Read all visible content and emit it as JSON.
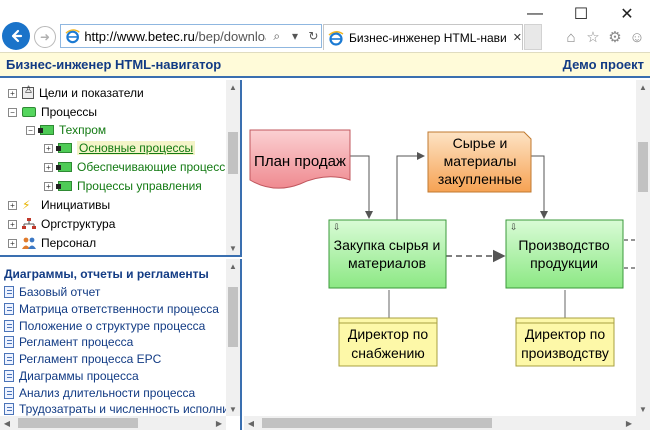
{
  "browser": {
    "url_domain": "http://www.betec.ru",
    "url_rest": "/bep/downloac",
    "tab_title": "Бизнес-инженер HTML-нави",
    "min": "—",
    "max": "☐",
    "close": "✕"
  },
  "app": {
    "title": "Бизнес-инженер HTML-навигатор",
    "project": "Демо проект"
  },
  "tree": {
    "items": [
      {
        "label": "Цели и показатели"
      },
      {
        "label": "Процессы"
      },
      {
        "label": "Техпром"
      },
      {
        "label": "Основные процессы"
      },
      {
        "label": "Обеспечивающие процессы"
      },
      {
        "label": "Процессы управления"
      },
      {
        "label": "Инициативы"
      },
      {
        "label": "Оргструктура"
      },
      {
        "label": "Персонал"
      }
    ]
  },
  "reports": {
    "title": "Диаграммы, отчеты и регламенты",
    "items": [
      "Базовый отчет",
      "Матрица ответственности процесса",
      "Положение о структуре процесса",
      "Регламент процесса",
      "Регламент процесса EPC",
      "Диаграммы процесса",
      "Анализ длительности процесса",
      "Трудозатраты и численность исполнителей"
    ]
  },
  "diagram": {
    "plan": "План продаж",
    "raw_1": "Сырье и",
    "raw_2": "материалы",
    "raw_3": "закупленные",
    "buy_1": "Закупка сырья и",
    "buy_2": "материалов",
    "prod_1": "Производство",
    "prod_2": "продукции",
    "dir1_1": "Директор по",
    "dir1_2": "снабжению",
    "dir2_1": "Директор по",
    "dir2_2": "производству"
  },
  "colors": {
    "accent": "#123b84",
    "header_bg": "#fffbd9",
    "process_fill": "#aaf2a8",
    "plan_fill": "#f5a3a8",
    "raw_fill": "#f9b772",
    "role_fill": "#fdf8a8"
  }
}
